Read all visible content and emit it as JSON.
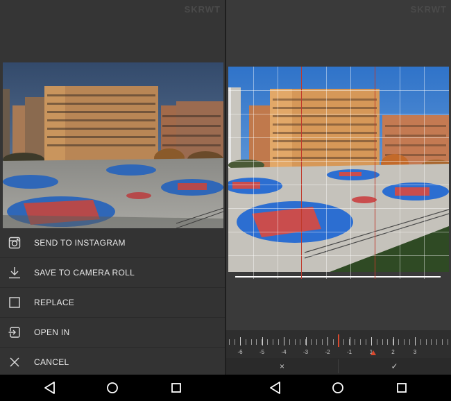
{
  "brand": "SKRWT",
  "share_menu": {
    "items": [
      {
        "label": "SEND TO INSTAGRAM",
        "icon": "instagram-icon"
      },
      {
        "label": "SAVE TO CAMERA ROLL",
        "icon": "download-icon"
      },
      {
        "label": "REPLACE",
        "icon": "square-icon"
      },
      {
        "label": "OPEN IN",
        "icon": "open-in-icon"
      },
      {
        "label": "CANCEL",
        "icon": "close-icon"
      }
    ]
  },
  "ruler": {
    "labels": [
      "-6",
      "-5",
      "-4",
      "-3",
      "-2",
      "-1",
      "1",
      "2",
      "3"
    ],
    "value": -1.5,
    "accent": "#d9492e"
  },
  "crop_actions": {
    "cancel_glyph": "×",
    "confirm_glyph": "✓"
  },
  "navbar": {
    "icons": [
      "back-icon",
      "home-icon",
      "recents-icon"
    ]
  }
}
